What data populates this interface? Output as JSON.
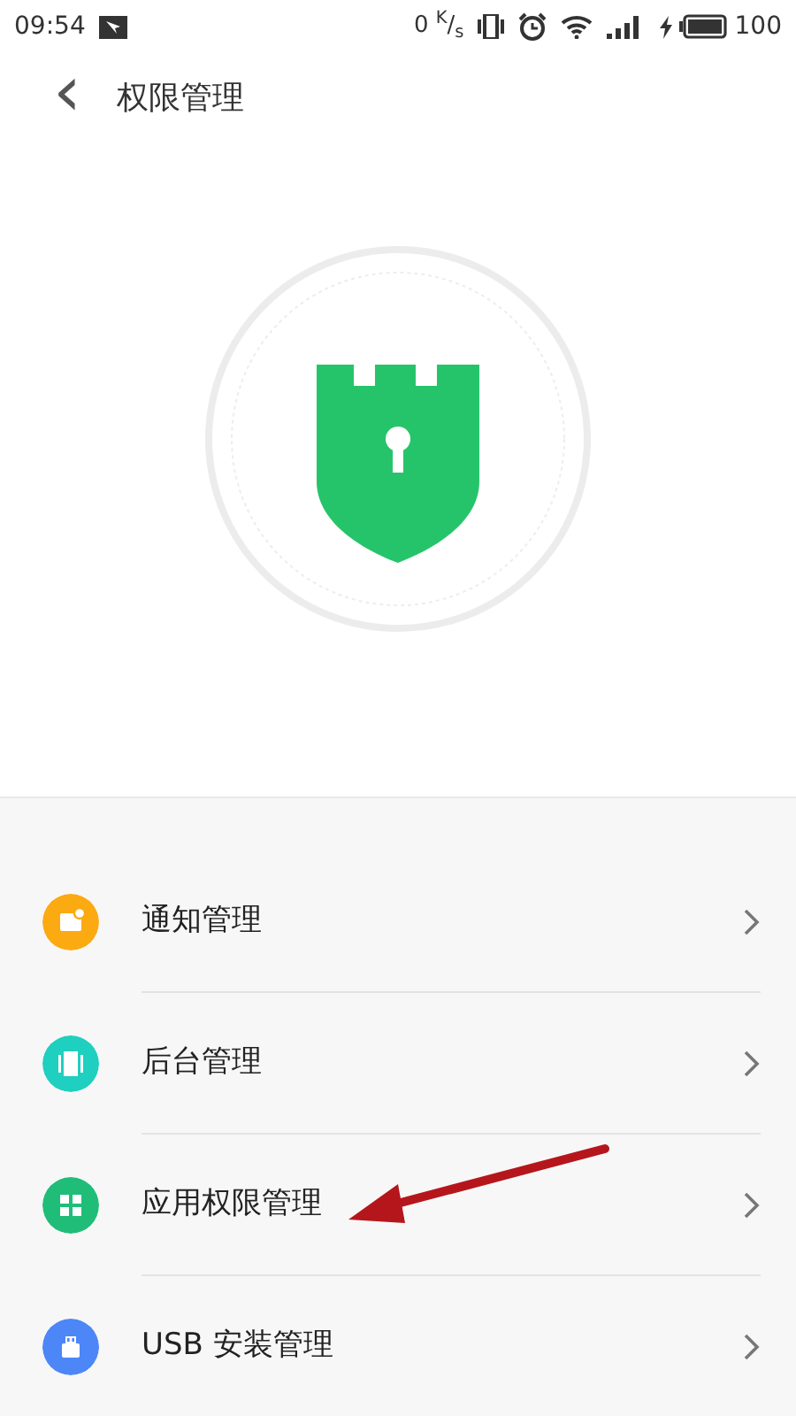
{
  "status_bar": {
    "time": "09:54",
    "speed": "0 $^{K}$/$_{s}$",
    "battery": "100"
  },
  "header": {
    "back": "‹",
    "title": "权限管理"
  },
  "items": [
    {
      "label": "通知管理",
      "kind": "notification",
      "color": "#fbaa12"
    },
    {
      "label": "后台管理",
      "kind": "background",
      "color": "#1fcfbf"
    },
    {
      "label": "应用权限管理",
      "kind": "apps",
      "color": "#20bd78"
    },
    {
      "label": "USB 安装管理",
      "kind": "usb",
      "color": "#4d87f7"
    }
  ],
  "annotation": {
    "kind": "arrow"
  }
}
